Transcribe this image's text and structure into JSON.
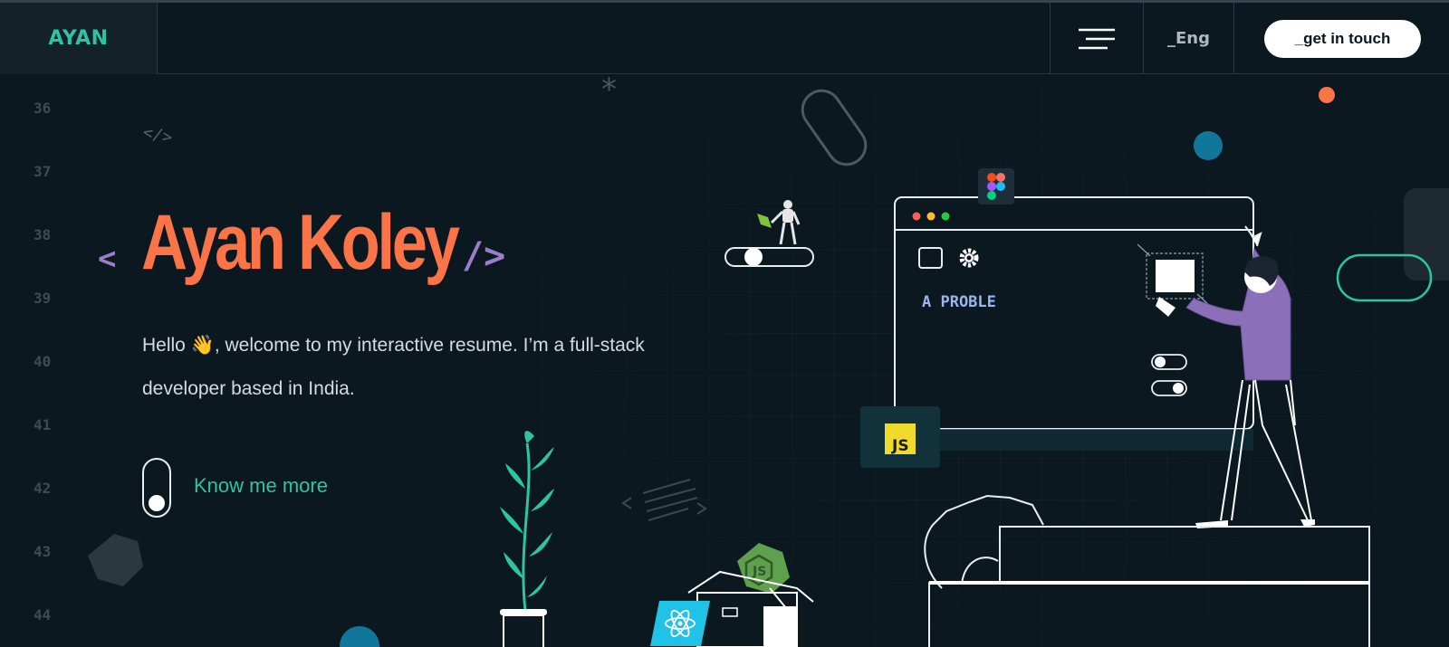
{
  "header": {
    "logo": "AYAN",
    "menu_icon": "hamburger-icon",
    "language": "_Eng",
    "cta_label": "_get in touch"
  },
  "line_numbers": [
    "36",
    "37",
    "38",
    "39",
    "40",
    "41",
    "42",
    "43",
    "44"
  ],
  "hero": {
    "open_tag": "<",
    "name": "Ayan Koley",
    "close_tag": "/>",
    "intro_line1": "Hello 👋, welcome to my interactive resume. I’m a full-stack",
    "intro_line2": "developer based in India.",
    "know_more_label": "Know me more"
  },
  "illustration": {
    "code_symbol": "</>",
    "window_text": "A PROBLE",
    "js_badge": "JS",
    "icons": [
      "figma-icon",
      "react-icon",
      "nodejs-icon",
      "gear-icon",
      "plant-icon",
      "superhero-icon"
    ]
  },
  "colors": {
    "background": "#0b1820",
    "accent_green": "#2ec4a0",
    "accent_orange": "#fb7447",
    "accent_purple": "#9b7ec8",
    "js_yellow": "#f0db2c",
    "react_cyan": "#20c3e6",
    "node_green": "#5fa04e"
  }
}
